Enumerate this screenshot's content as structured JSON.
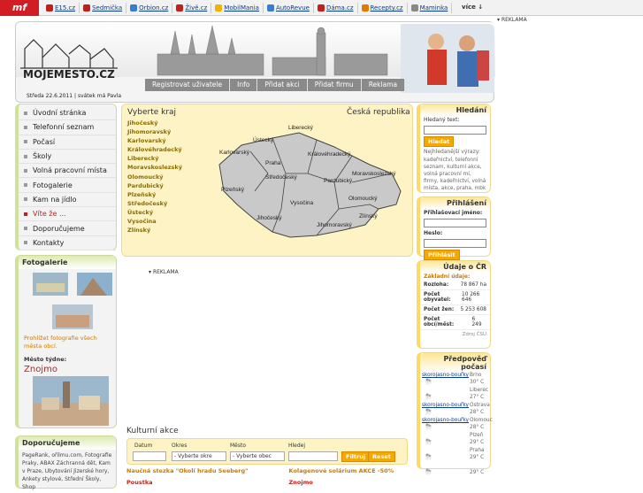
{
  "topbar": {
    "logo": "mf",
    "links": [
      {
        "label": "E15.cz",
        "color": "#c0201c"
      },
      {
        "label": "Sedmička",
        "color": "#c0201c"
      },
      {
        "label": "Orbion.cz",
        "color": "#3a7bd5"
      },
      {
        "label": "Živě.cz",
        "color": "#c0201c"
      },
      {
        "label": "MobilMania",
        "color": "#f0b400"
      },
      {
        "label": "AutoRevue",
        "color": "#3a7bd5"
      },
      {
        "label": "Dáma.cz",
        "color": "#c0201c"
      },
      {
        "label": "Recepty.cz",
        "color": "#e07b00"
      },
      {
        "label": "Maminka",
        "color": "#888888"
      }
    ],
    "more": "více"
  },
  "reklama": "REKLAMA",
  "header": {
    "brand": "MOJEMESTO.CZ",
    "nav": [
      "Registrovat uživatele",
      "Info",
      "Přidat akci",
      "Přidat firmu",
      "Reklama"
    ],
    "date": "Středa 22.6.2011 | svátek má Pavla"
  },
  "menu": [
    {
      "label": "Úvodní stránka",
      "active": false
    },
    {
      "label": "Telefonní seznam",
      "active": false
    },
    {
      "label": "Počasí",
      "active": false
    },
    {
      "label": "Školy",
      "active": false
    },
    {
      "label": "Volná pracovní místa",
      "active": false
    },
    {
      "label": "Fotogalerie",
      "active": false
    },
    {
      "label": "Kam na jídlo",
      "active": false
    },
    {
      "label": "Víte že ...",
      "active": true
    },
    {
      "label": "Doporučujeme",
      "active": false
    },
    {
      "label": "Kontakty",
      "active": false
    }
  ],
  "fotogalerie": {
    "title": "Fotogalerie",
    "link": "Prohlížet fotografie všech města obcí.",
    "city_label": "Město týdne:",
    "city": "Znojmo"
  },
  "doporucujeme": {
    "title": "Doporučujeme",
    "text": "PageRank, ořilmu.com, Fotografie Praky, ABAX Záchranná dět, Kam v Praze, Ubytování Jizerské hory, Ankety stylové, Střední Školy, Shop"
  },
  "map": {
    "heading": "Vyberte kraj",
    "country": "Česká republika",
    "kraje": [
      "Jihočeský",
      "Jihomoravský",
      "Karlovarský",
      "Královéhradecký",
      "Liberecký",
      "Moravskoslezský",
      "Olomoucký",
      "Pardubický",
      "Plzeňský",
      "Středočeský",
      "Ústecký",
      "Vysočina",
      "Zlínský"
    ],
    "labels": [
      "Ústecký",
      "Liberecký",
      "Karlovarský",
      "Královéhradecký",
      "Praha",
      "Středočeský",
      "Pardubický",
      "Plzeňský",
      "Moravskoslezský",
      "Vysočina",
      "Olomoucký",
      "Jihočeský",
      "Zlínský",
      "Jihomoravský"
    ]
  },
  "search": {
    "title": "Hledání",
    "label": "Hledaný text:",
    "button": "Hledat",
    "popular": "Nejhledanější výrazy:",
    "terms": "kadeřnictví, telefonní seznam, kulturní akce, volná pracovní mí, firmy, kadeřnictví, volná místa, akce, praha, mbk"
  },
  "login": {
    "title": "Přihlášení",
    "user": "Přihlašovací jméno:",
    "pass": "Heslo:",
    "button": "Přihlásit"
  },
  "udaje": {
    "title": "Údaje o ČR",
    "sub": "Základní údaje:",
    "rows": [
      {
        "k": "Rozloha:",
        "v": "78 867 ha"
      },
      {
        "k": "Počet obyvatel:",
        "v": "10 266 646"
      },
      {
        "k": "Počet žen:",
        "v": "5 253 608"
      },
      {
        "k": "Počet obcí/měst:",
        "v": "6 249"
      }
    ],
    "link": "Zdroj ČSÚ"
  },
  "pocasi": {
    "title": "Předpověď počasí",
    "items": [
      {
        "cond": "skorojasno-bouřky",
        "city": "Brno",
        "temp": "30° C"
      },
      {
        "cond": "",
        "city": "Liberec",
        "temp": "27° C"
      },
      {
        "cond": "skorojasno-bouřky",
        "city": "Ostrava",
        "temp": "28° C"
      },
      {
        "cond": "skorojasno-bouřky",
        "city": "Olomouc",
        "temp": "28° C"
      },
      {
        "cond": "",
        "city": "Plzeň",
        "temp": "29° C"
      },
      {
        "cond": "",
        "city": "Praha",
        "temp": "29° C"
      },
      {
        "cond": "",
        "city": "",
        "temp": "29° C"
      }
    ]
  },
  "kulturni": {
    "title": "Kulturní akce",
    "labels": [
      "Datum",
      "Okres",
      "Město",
      "Hledej"
    ],
    "okres": "- Vyberte okre",
    "mesto": "- Vyberte obec",
    "filtruj": "Filtruj",
    "reset": "Reset",
    "events": [
      {
        "t": "Naučná stezka \"Okolí hradu Seeberg\"",
        "p": "Poustka"
      },
      {
        "t": "Kolagenové solárium AKCE -50%",
        "p": "Znojmo"
      }
    ]
  }
}
